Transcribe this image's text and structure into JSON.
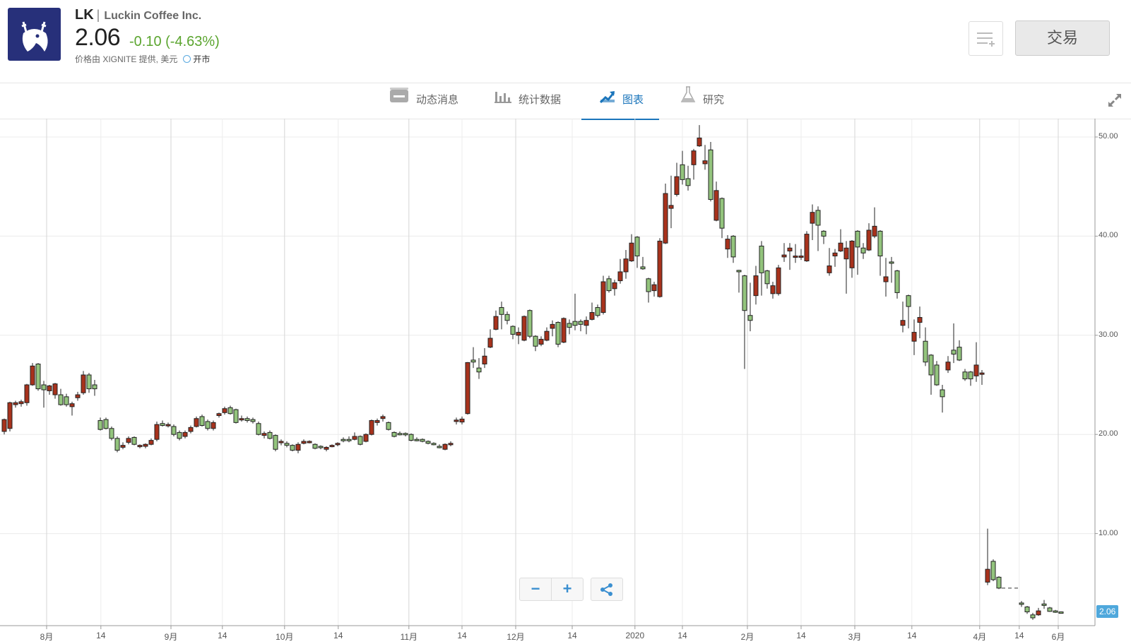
{
  "header": {
    "symbol": "LK",
    "separator": "|",
    "company": "Luckin Coffee Inc.",
    "price": "2.06",
    "change": "-0.10 (-4.63%)",
    "source": "价格由 XIGNITE 提供, 美元",
    "market_status": "开市",
    "trade_label": "交易",
    "change_color": "#5ba52f",
    "logo_color": "#27307a"
  },
  "tabs": [
    {
      "label": "动态消息",
      "icon": "news-icon"
    },
    {
      "label": "统计数据",
      "icon": "bar-stats-icon"
    },
    {
      "label": "图表",
      "icon": "chart-icon",
      "active": true
    },
    {
      "label": "研究",
      "icon": "flask-icon"
    }
  ],
  "zoom_controls": {
    "minus": "−",
    "plus": "+"
  },
  "chart_data": {
    "type": "candlestick",
    "ylim": [
      0,
      51.5
    ],
    "y_ticks": [
      "10.00",
      "20.00",
      "30.00",
      "40.00",
      "50.00"
    ],
    "y_tick_values": [
      10,
      20,
      30,
      40,
      50
    ],
    "last_price_label": "2.06",
    "x_ticks": [
      {
        "label": "8月",
        "index": 7.5
      },
      {
        "label": "14",
        "index": 17.1
      },
      {
        "label": "9月",
        "index": 29.5
      },
      {
        "label": "14",
        "index": 38.6
      },
      {
        "label": "10月",
        "index": 49.6
      },
      {
        "label": "14",
        "index": 59.1
      },
      {
        "label": "11月",
        "index": 71.6
      },
      {
        "label": "14",
        "index": 81
      },
      {
        "label": "12月",
        "index": 90.5
      },
      {
        "label": "14",
        "index": 100.5
      },
      {
        "label": "2020",
        "index": 111.6
      },
      {
        "label": "14",
        "index": 120
      },
      {
        "label": "2月",
        "index": 131.5
      },
      {
        "label": "14",
        "index": 141
      },
      {
        "label": "3月",
        "index": 150.5
      },
      {
        "label": "14",
        "index": 160.6
      },
      {
        "label": "4月",
        "index": 172.6
      },
      {
        "label": "14",
        "index": 179.6
      },
      {
        "label": "6月",
        "index": 186.5
      }
    ],
    "up_color": "#a8321c",
    "down_color": "#93c47d",
    "ohlc_format": [
      "open",
      "high",
      "low",
      "close"
    ],
    "candles": [
      [
        20.3,
        21.6,
        20.0,
        21.5
      ],
      [
        20.6,
        23.3,
        20.3,
        23.2
      ],
      [
        23.0,
        23.4,
        22.7,
        23.2
      ],
      [
        23.1,
        23.5,
        22.8,
        23.3
      ],
      [
        23.2,
        25.1,
        22.9,
        25.0
      ],
      [
        25.0,
        27.2,
        24.9,
        26.9
      ],
      [
        27.1,
        27.2,
        24.4,
        24.6
      ],
      [
        25.0,
        25.4,
        22.7,
        24.5
      ],
      [
        24.4,
        25.0,
        24.0,
        24.9
      ],
      [
        24.0,
        25.2,
        23.6,
        25.1
      ],
      [
        24.0,
        24.6,
        22.9,
        23.0
      ],
      [
        23.8,
        24.1,
        22.8,
        23.0
      ],
      [
        22.8,
        23.3,
        21.9,
        23.1
      ],
      [
        23.7,
        24.3,
        23.4,
        24.0
      ],
      [
        24.2,
        26.4,
        24.0,
        26.0
      ],
      [
        26.0,
        26.2,
        24.2,
        24.6
      ],
      [
        25.0,
        25.5,
        23.9,
        24.6
      ],
      [
        21.4,
        21.7,
        20.4,
        20.5
      ],
      [
        21.5,
        21.7,
        20.5,
        20.6
      ],
      [
        20.6,
        20.8,
        19.4,
        19.6
      ],
      [
        19.6,
        19.8,
        18.2,
        18.4
      ],
      [
        18.7,
        19.2,
        18.5,
        18.9
      ],
      [
        19.2,
        19.8,
        19.0,
        19.6
      ],
      [
        19.7,
        19.8,
        18.9,
        19.0
      ],
      [
        18.8,
        19.0,
        18.6,
        18.9
      ],
      [
        18.8,
        19.1,
        18.6,
        19.0
      ],
      [
        19.0,
        19.6,
        18.9,
        19.4
      ],
      [
        19.5,
        21.3,
        19.3,
        21.0
      ],
      [
        21.1,
        21.4,
        20.8,
        20.9
      ],
      [
        20.9,
        21.2,
        20.7,
        21.0
      ],
      [
        20.8,
        21.0,
        19.8,
        20.0
      ],
      [
        20.2,
        20.4,
        19.4,
        19.6
      ],
      [
        19.8,
        20.4,
        19.6,
        20.2
      ],
      [
        20.3,
        20.9,
        20.1,
        20.7
      ],
      [
        20.8,
        21.8,
        20.7,
        21.6
      ],
      [
        21.8,
        22.0,
        20.8,
        20.9
      ],
      [
        21.3,
        21.5,
        20.4,
        20.6
      ],
      [
        20.6,
        21.4,
        20.4,
        21.2
      ],
      [
        21.9,
        22.2,
        21.7,
        22.1
      ],
      [
        22.2,
        22.8,
        22.0,
        22.6
      ],
      [
        22.7,
        22.9,
        22.0,
        22.1
      ],
      [
        22.5,
        22.6,
        21.1,
        21.2
      ],
      [
        21.5,
        21.9,
        21.3,
        21.6
      ],
      [
        21.6,
        21.8,
        21.2,
        21.4
      ],
      [
        21.5,
        21.7,
        21.1,
        21.3
      ],
      [
        21.1,
        21.3,
        19.9,
        20.0
      ],
      [
        19.9,
        20.3,
        19.6,
        20.1
      ],
      [
        20.2,
        20.4,
        19.5,
        19.6
      ],
      [
        19.9,
        20.0,
        18.3,
        18.5
      ],
      [
        19.2,
        19.5,
        18.9,
        19.3
      ],
      [
        19.1,
        19.3,
        18.7,
        18.9
      ],
      [
        18.9,
        19.0,
        18.3,
        18.4
      ],
      [
        18.4,
        19.2,
        18.1,
        19.0
      ],
      [
        19.1,
        19.5,
        19.0,
        19.3
      ],
      [
        19.2,
        19.4,
        19.1,
        19.3
      ],
      [
        19.0,
        19.1,
        18.5,
        18.6
      ],
      [
        18.8,
        18.9,
        18.5,
        18.7
      ],
      [
        18.5,
        18.8,
        18.3,
        18.7
      ],
      [
        18.8,
        19.0,
        18.7,
        18.9
      ],
      [
        19.0,
        19.2,
        18.8,
        19.1
      ],
      [
        19.5,
        19.7,
        19.2,
        19.4
      ],
      [
        19.5,
        19.8,
        19.2,
        19.4
      ],
      [
        19.5,
        20.2,
        19.4,
        19.8
      ],
      [
        19.8,
        19.9,
        18.9,
        19.0
      ],
      [
        19.3,
        20.1,
        19.2,
        20.0
      ],
      [
        20.0,
        21.5,
        19.9,
        21.4
      ],
      [
        21.2,
        21.6,
        20.9,
        21.4
      ],
      [
        21.6,
        22.0,
        21.3,
        21.8
      ],
      [
        21.2,
        21.3,
        20.4,
        20.5
      ],
      [
        20.2,
        20.3,
        19.7,
        19.8
      ],
      [
        20.1,
        20.3,
        19.9,
        20.0
      ],
      [
        20.1,
        20.2,
        19.8,
        20.0
      ],
      [
        20.0,
        20.1,
        19.3,
        19.4
      ],
      [
        19.5,
        19.7,
        19.3,
        19.4
      ],
      [
        19.5,
        19.6,
        19.2,
        19.3
      ],
      [
        19.3,
        19.4,
        19.0,
        19.1
      ],
      [
        19.1,
        19.2,
        18.9,
        19.0
      ],
      [
        18.8,
        19.0,
        18.6,
        18.7
      ],
      [
        18.5,
        19.1,
        18.4,
        19.0
      ],
      [
        19.0,
        19.3,
        18.8,
        19.1
      ],
      [
        21.3,
        21.7,
        21.0,
        21.45
      ],
      [
        21.25,
        21.8,
        21.0,
        21.55
      ],
      [
        22.1,
        27.3,
        22.0,
        27.25
      ],
      [
        27.5,
        28.8,
        26.7,
        27.3
      ],
      [
        26.7,
        27.7,
        25.6,
        26.3
      ],
      [
        27.1,
        28.7,
        26.7,
        27.9
      ],
      [
        28.8,
        30.6,
        28.7,
        29.7
      ],
      [
        30.6,
        32.5,
        30.5,
        31.9
      ],
      [
        32.8,
        33.4,
        30.6,
        32.1
      ],
      [
        32.1,
        32.4,
        31.1,
        31.5
      ],
      [
        30.9,
        31.0,
        29.6,
        30.1
      ],
      [
        30.0,
        30.8,
        29.1,
        30.3
      ],
      [
        29.5,
        32.0,
        29.4,
        31.9
      ],
      [
        32.5,
        32.6,
        29.7,
        29.9
      ],
      [
        29.9,
        30.0,
        28.4,
        28.9
      ],
      [
        29.1,
        29.9,
        28.9,
        29.6
      ],
      [
        29.5,
        30.8,
        29.4,
        30.4
      ],
      [
        30.7,
        31.5,
        29.9,
        31.1
      ],
      [
        31.3,
        31.4,
        28.8,
        29.1
      ],
      [
        29.3,
        31.8,
        29.2,
        31.7
      ],
      [
        31.2,
        31.6,
        30.1,
        30.8
      ],
      [
        31.4,
        34.2,
        30.5,
        31.0
      ],
      [
        31.4,
        31.6,
        30.4,
        31.1
      ],
      [
        31.0,
        31.9,
        30.1,
        31.5
      ],
      [
        31.6,
        33.3,
        31.5,
        32.3
      ],
      [
        32.8,
        33.1,
        31.8,
        32.0
      ],
      [
        32.3,
        36.0,
        32.1,
        35.4
      ],
      [
        35.7,
        36.0,
        34.3,
        34.5
      ],
      [
        34.7,
        35.6,
        34.0,
        35.3
      ],
      [
        35.5,
        37.7,
        35.2,
        36.4
      ],
      [
        36.4,
        38.6,
        35.7,
        37.7
      ],
      [
        37.5,
        40.2,
        37.4,
        39.3
      ],
      [
        39.9,
        40.0,
        36.8,
        38.0
      ],
      [
        36.9,
        37.9,
        36.6,
        36.7
      ],
      [
        35.7,
        35.8,
        33.3,
        34.4
      ],
      [
        34.5,
        35.4,
        33.9,
        35.1
      ],
      [
        33.9,
        39.8,
        33.8,
        39.5
      ],
      [
        39.3,
        45.3,
        39.2,
        44.3
      ],
      [
        42.8,
        46.1,
        40.8,
        43.1
      ],
      [
        44.2,
        47.4,
        44.0,
        46.0
      ],
      [
        47.2,
        48.6,
        45.2,
        45.7
      ],
      [
        45.8,
        47.1,
        44.6,
        45.1
      ],
      [
        47.2,
        48.8,
        45.7,
        48.6
      ],
      [
        49.1,
        51.2,
        49.0,
        49.9
      ],
      [
        47.3,
        49.2,
        46.7,
        47.6
      ],
      [
        48.7,
        49.5,
        43.5,
        43.7
      ],
      [
        41.6,
        45.5,
        41.5,
        44.6
      ],
      [
        43.8,
        43.9,
        39.8,
        40.8
      ],
      [
        38.7,
        40.1,
        37.8,
        39.7
      ],
      [
        40.0,
        40.1,
        37.3,
        37.9
      ],
      [
        36.55,
        36.6,
        34.3,
        36.4
      ],
      [
        36.0,
        36.1,
        26.6,
        32.5
      ],
      [
        32.0,
        35.3,
        30.4,
        31.5
      ],
      [
        34.0,
        37.0,
        33.1,
        36.0
      ],
      [
        39.0,
        39.5,
        34.0,
        36.3
      ],
      [
        36.5,
        36.6,
        34.7,
        35.2
      ],
      [
        34.2,
        35.4,
        33.7,
        35.0
      ],
      [
        34.2,
        37.1,
        34.0,
        36.8
      ],
      [
        37.9,
        39.3,
        37.4,
        38.1
      ],
      [
        38.5,
        39.3,
        36.6,
        38.8
      ],
      [
        37.9,
        39.2,
        37.3,
        38.0
      ],
      [
        37.9,
        38.7,
        37.6,
        38.0
      ],
      [
        37.5,
        40.5,
        37.4,
        40.2
      ],
      [
        41.3,
        43.2,
        39.6,
        42.4
      ],
      [
        42.6,
        43.0,
        38.5,
        41.1
      ],
      [
        40.5,
        40.6,
        39.2,
        40.0
      ],
      [
        36.3,
        38.8,
        36.0,
        37.0
      ],
      [
        38.0,
        38.7,
        36.9,
        38.3
      ],
      [
        38.5,
        40.7,
        38.4,
        39.3
      ],
      [
        37.7,
        39.5,
        34.2,
        38.8
      ],
      [
        36.8,
        39.6,
        35.8,
        39.5
      ],
      [
        40.5,
        40.6,
        36.1,
        38.9
      ],
      [
        38.8,
        39.3,
        37.7,
        38.3
      ],
      [
        38.6,
        41.3,
        38.5,
        40.6
      ],
      [
        40.0,
        42.9,
        39.8,
        41.0
      ],
      [
        40.5,
        40.6,
        36.0,
        38.0
      ],
      [
        35.4,
        37.8,
        33.9,
        35.9
      ],
      [
        37.4,
        37.9,
        35.3,
        37.3
      ],
      [
        36.5,
        36.6,
        33.7,
        34.3
      ],
      [
        31.0,
        33.4,
        30.3,
        31.5
      ],
      [
        34.0,
        34.1,
        30.7,
        32.9
      ],
      [
        29.4,
        31.6,
        28.0,
        30.3
      ],
      [
        31.3,
        32.9,
        29.7,
        31.8
      ],
      [
        29.4,
        30.8,
        26.9,
        27.3
      ],
      [
        28.0,
        28.1,
        24.0,
        26.0
      ],
      [
        27.0,
        27.4,
        24.9,
        25.0
      ],
      [
        24.5,
        25.0,
        22.2,
        23.8
      ],
      [
        26.5,
        27.9,
        26.2,
        27.3
      ],
      [
        28.5,
        31.2,
        27.2,
        28.1
      ],
      [
        28.8,
        29.5,
        27.4,
        27.5
      ],
      [
        26.3,
        26.6,
        25.4,
        25.6
      ],
      [
        26.3,
        26.4,
        24.9,
        25.6
      ],
      [
        25.9,
        29.3,
        25.3,
        27.0
      ],
      [
        26.1,
        26.5,
        25.0,
        26.2
      ],
      [
        5.1,
        10.5,
        4.8,
        6.4
      ],
      [
        7.2,
        7.4,
        5.2,
        5.35
      ],
      [
        5.6,
        5.7,
        4.4,
        4.5
      ],
      null,
      null,
      null,
      [
        3.0,
        3.2,
        2.6,
        2.9
      ],
      [
        2.6,
        2.7,
        1.9,
        2.1
      ],
      [
        1.8,
        2.0,
        1.3,
        1.5
      ],
      [
        1.8,
        2.5,
        1.7,
        2.2
      ],
      [
        2.9,
        3.3,
        2.4,
        2.75
      ],
      [
        2.5,
        2.6,
        2.1,
        2.15
      ],
      [
        2.2,
        2.3,
        2.0,
        2.06
      ],
      [
        2.1,
        2.15,
        2.0,
        2.06
      ]
    ]
  }
}
